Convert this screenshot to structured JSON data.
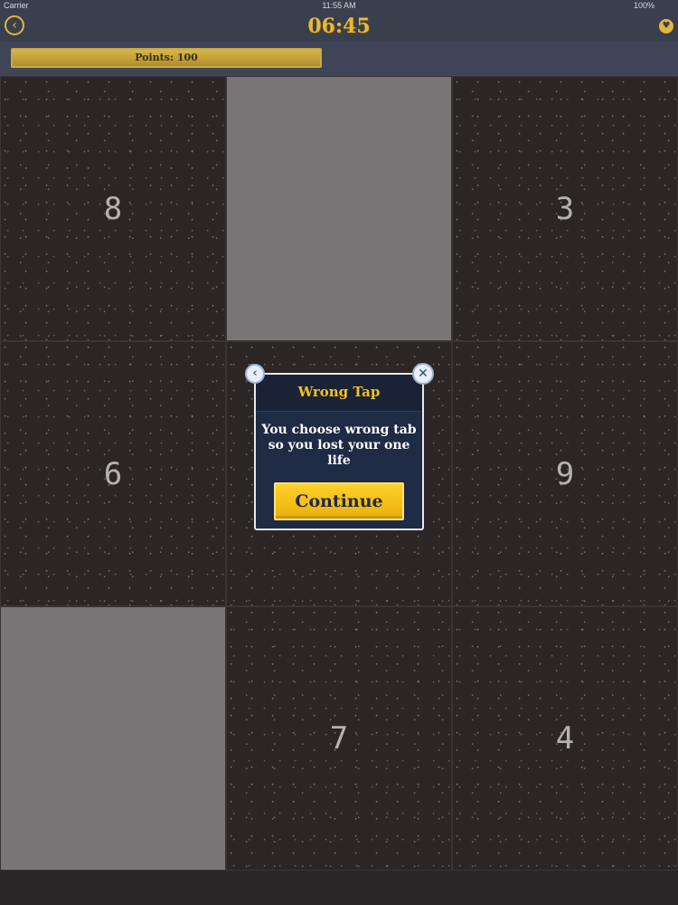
{
  "status_bar": {
    "carrier": "Carrier",
    "time": "11:55 AM",
    "battery": "100%"
  },
  "header": {
    "back_icon": "‹",
    "timer": "06:45",
    "heart_icon": "♥"
  },
  "points": {
    "label": "Points: 100"
  },
  "grid": {
    "cells": [
      {
        "number": "8",
        "revealed": false
      },
      {
        "number": "",
        "revealed": true
      },
      {
        "number": "3",
        "revealed": false
      },
      {
        "number": "6",
        "revealed": false
      },
      {
        "number": "",
        "revealed": false
      },
      {
        "number": "9",
        "revealed": false
      },
      {
        "number": "",
        "revealed": true
      },
      {
        "number": "7",
        "revealed": false
      },
      {
        "number": "4",
        "revealed": false
      }
    ]
  },
  "dialog": {
    "title": "Wrong Tap",
    "message": "You choose wrong tab so you lost your one life",
    "button_label": "Continue",
    "back_icon": "‹",
    "close_icon": "✕"
  }
}
